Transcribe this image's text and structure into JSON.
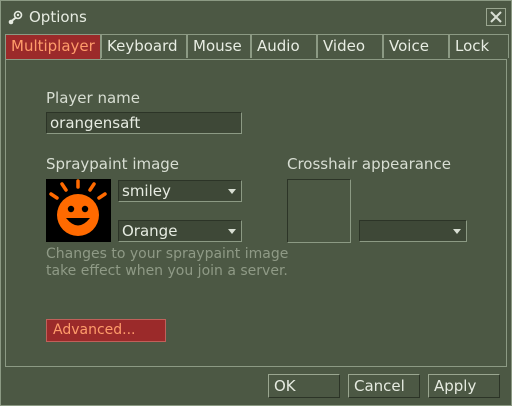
{
  "window": {
    "title": "Options",
    "app_icon": "steam-icon",
    "close_icon": "close-icon"
  },
  "tabs": [
    {
      "label": "Multiplayer",
      "active": true
    },
    {
      "label": "Keyboard",
      "active": false
    },
    {
      "label": "Mouse",
      "active": false
    },
    {
      "label": "Audio",
      "active": false
    },
    {
      "label": "Video",
      "active": false
    },
    {
      "label": "Voice",
      "active": false
    },
    {
      "label": "Lock",
      "active": false
    }
  ],
  "multiplayer": {
    "player_name_label": "Player name",
    "player_name_value": "orangensaft",
    "spraypaint_label": "Spraypaint image",
    "spray_image_select": "smiley",
    "spray_color_select": "Orange",
    "spray_hint": "Changes to your spraypaint image take effect when you join a server.",
    "crosshair_label": "Crosshair appearance",
    "crosshair_select": "",
    "advanced_label": "Advanced..."
  },
  "buttons": {
    "ok": "OK",
    "cancel": "Cancel",
    "apply": "Apply"
  },
  "colors": {
    "background": "#4c5844",
    "accent": "#9b2a2a",
    "accent_text": "#ff9c6a",
    "spray_color": "#ff6a00"
  }
}
